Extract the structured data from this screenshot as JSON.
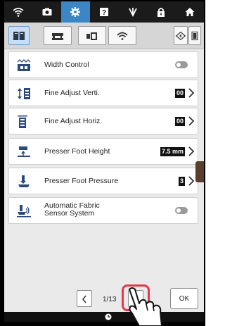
{
  "topbar": {
    "icons": [
      "wifi-icon",
      "camera-icon",
      "settings-icon",
      "help-icon",
      "thread-icon",
      "lock-icon",
      "home-icon"
    ],
    "active": "settings-icon"
  },
  "tabs": [
    "machine-settings-tab",
    "sewing-settings-tab",
    "embroidery-settings-tab",
    "wireless-tab"
  ],
  "settings": [
    {
      "label": "Width Control",
      "type": "toggle"
    },
    {
      "label": "Fine Adjust Verti.",
      "type": "value",
      "value": "00"
    },
    {
      "label": "Fine Adjust Horiz.",
      "type": "value",
      "value": "00"
    },
    {
      "label": "Presser Foot Height",
      "type": "value",
      "value": "7.5 mm"
    },
    {
      "label": "Presser Foot Pressure",
      "type": "value",
      "value": "3"
    },
    {
      "label_line1": "Automatic Fabric",
      "label_line2": "Sensor System",
      "type": "toggle"
    }
  ],
  "pager": {
    "indicator": "1/13"
  },
  "ok_label": "OK",
  "colors": {
    "accent": "#3d86c6",
    "highlight": "#e23a4a"
  }
}
